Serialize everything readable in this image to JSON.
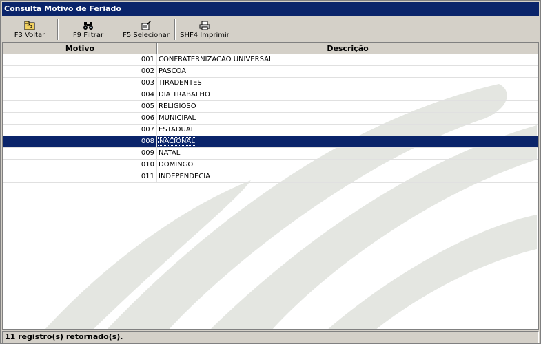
{
  "window": {
    "title": "Consulta Motivo de Feriado"
  },
  "toolbar": {
    "buttons": [
      {
        "label": "F3 Voltar",
        "icon": "back-folder-icon"
      },
      {
        "label": "F9 Filtrar",
        "icon": "binoculars-icon"
      },
      {
        "label": "F5 Selecionar",
        "icon": "select-icon"
      },
      {
        "label": "SHF4 Imprimir",
        "icon": "printer-icon"
      }
    ]
  },
  "grid": {
    "columns": [
      "Motivo",
      "Descrição"
    ],
    "rows": [
      {
        "motivo": "001",
        "descricao": "CONFRATERNIZACAO UNIVERSAL"
      },
      {
        "motivo": "002",
        "descricao": "PASCOA"
      },
      {
        "motivo": "003",
        "descricao": "TIRADENTES"
      },
      {
        "motivo": "004",
        "descricao": "DIA TRABALHO"
      },
      {
        "motivo": "005",
        "descricao": "RELIGIOSO"
      },
      {
        "motivo": "006",
        "descricao": "MUNICIPAL"
      },
      {
        "motivo": "007",
        "descricao": "ESTADUAL"
      },
      {
        "motivo": "008",
        "descricao": "NACIONAL"
      },
      {
        "motivo": "009",
        "descricao": "NATAL"
      },
      {
        "motivo": "010",
        "descricao": "DOMINGO"
      },
      {
        "motivo": "011",
        "descricao": "INDEPENDECIA"
      }
    ],
    "selected_index": 7
  },
  "status": {
    "text": "11 registro(s) retornado(s)."
  },
  "colors": {
    "title_bg": "#0a246a",
    "selection_bg": "#0a246a",
    "window_bg": "#d4d0c8",
    "watermark": "#e4e6e1"
  }
}
